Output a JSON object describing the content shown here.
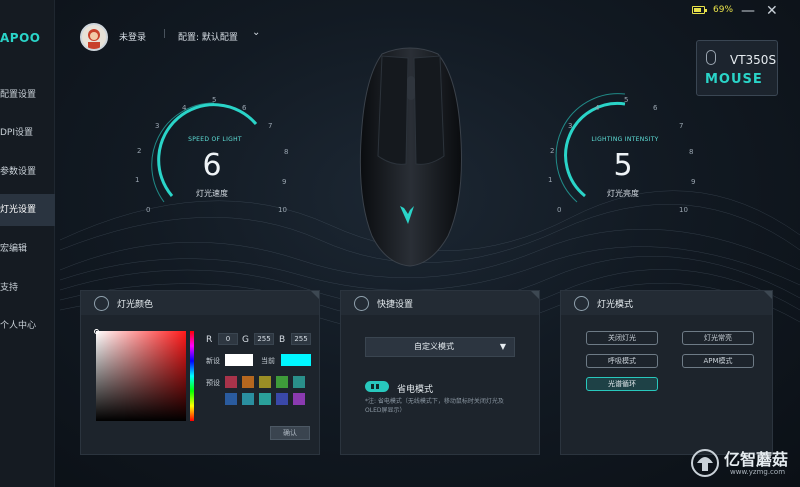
{
  "window": {
    "battery_pct": "69%",
    "minimize_label": "—",
    "close_label": "✕",
    "battery_color": "#e8e24a"
  },
  "brand": {
    "logo_text": "APOO",
    "accent": "#2ad4c8"
  },
  "sidebar": {
    "items": [
      {
        "label": "配置设置"
      },
      {
        "label": "DPI设置"
      },
      {
        "label": "参数设置"
      },
      {
        "label": "灯光设置"
      },
      {
        "label": "宏编辑"
      },
      {
        "label": "支持"
      },
      {
        "label": "个人中心"
      }
    ]
  },
  "header": {
    "user": "未登录",
    "separator": "|",
    "profile": "配置: 默认配置"
  },
  "device": {
    "model": "VT350S",
    "sub": "MOUSE"
  },
  "speed_gauge": {
    "title": "SPEED OF LIGHT",
    "value": "6",
    "label": "灯光速度",
    "ticks": [
      "0",
      "1",
      "2",
      "3",
      "4",
      "5",
      "6",
      "7",
      "8",
      "9",
      "10"
    ]
  },
  "intensity_gauge": {
    "title": "LIGHTING INTENSITY",
    "value": "5",
    "label": "灯光亮度",
    "ticks": [
      "0",
      "1",
      "2",
      "3",
      "4",
      "5",
      "6",
      "7",
      "8",
      "9",
      "10"
    ]
  },
  "color_panel": {
    "title": "灯光颜色",
    "r_label": "R",
    "r_value": "0",
    "g_label": "G",
    "g_value": "255",
    "b_label": "B",
    "b_value": "255",
    "new_label": "新设",
    "current_label": "当前",
    "new_color": "#ffffff",
    "current_color": "#00f6ff",
    "preset_label": "预设",
    "presets": [
      "#a8334a",
      "#b5671f",
      "#9a8e25",
      "#3e9b3a",
      "#2a8f8a",
      "#2a5b9e",
      "#2a8fa0",
      "#2aa09a",
      "#3a48a8",
      "#8a3ab0"
    ],
    "confirm_label": "确认"
  },
  "shortcut_panel": {
    "title": "快捷设置",
    "select_value": "自定义模式",
    "power_label": "省电模式",
    "note": "*注: 省电模式（无线模式下，移动鼠标时关闭灯光及OLED屏显示）"
  },
  "mode_panel": {
    "title": "灯光模式",
    "buttons": [
      {
        "label": "关闭灯光"
      },
      {
        "label": "灯光常亮"
      },
      {
        "label": "呼吸模式"
      },
      {
        "label": "APM模式"
      },
      {
        "label": "光谱循环"
      }
    ]
  },
  "watermark": {
    "name": "亿智蘑菇",
    "url": "www.yzmg.com"
  }
}
